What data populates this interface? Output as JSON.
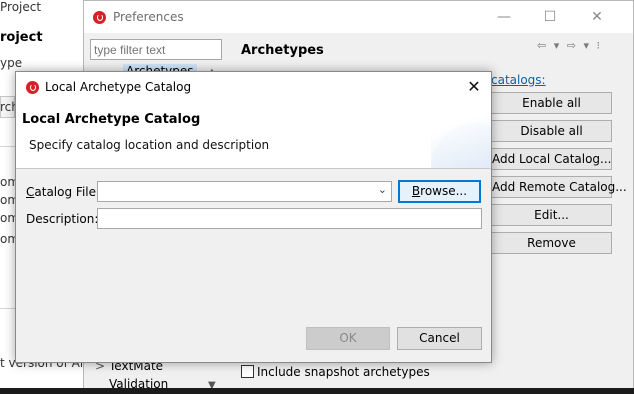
{
  "background": {
    "project_label": "Project",
    "project_heading": "roject",
    "type_label": "ype",
    "arch_label": "rch",
    "list_items": [
      "omi",
      "omi",
      "omi",
      "omi"
    ],
    "version_text": "t version of Arc"
  },
  "preferences": {
    "title": "Preferences",
    "window_controls": {
      "minimize": "—",
      "maximize": "☐",
      "close": "✕"
    },
    "filter_placeholder": "type filter text",
    "tree_items": {
      "archetypes": "Archetypes",
      "textmate": "TextMate",
      "validation": "Validation"
    },
    "tree_expander": ">",
    "page_title": "Archetypes",
    "nav_arrows": "⇦ ▾ ⇨ ▾ ⁝",
    "catalogs_link": "catalogs:",
    "buttons": {
      "enable_all": "Enable all",
      "disable_all": "Disable all",
      "add_local": "Add Local Catalog...",
      "add_remote": "Add Remote Catalog...",
      "edit": "Edit...",
      "remove": "Remove"
    },
    "snapshot_label": "Include snapshot archetypes",
    "scroll_up": "▲",
    "scroll_down": "▼"
  },
  "dialog": {
    "title": "Local Archetype Catalog",
    "close_glyph": "✕",
    "heading": "Local Archetype Catalog",
    "description": "Specify catalog location and description",
    "catalog_file_mnemonic": "C",
    "catalog_file_rest": "atalog File:",
    "catalog_file_value": "",
    "combo_arrow": "⌄",
    "description_label": "Description:",
    "description_value": "",
    "browse_mnemonic": "B",
    "browse_rest": "rowse...",
    "ok_label": "OK",
    "cancel_label": "Cancel"
  },
  "colors": {
    "accent": "#0078d7",
    "link": "#0e5ea8",
    "app_icon": "#d52128"
  }
}
